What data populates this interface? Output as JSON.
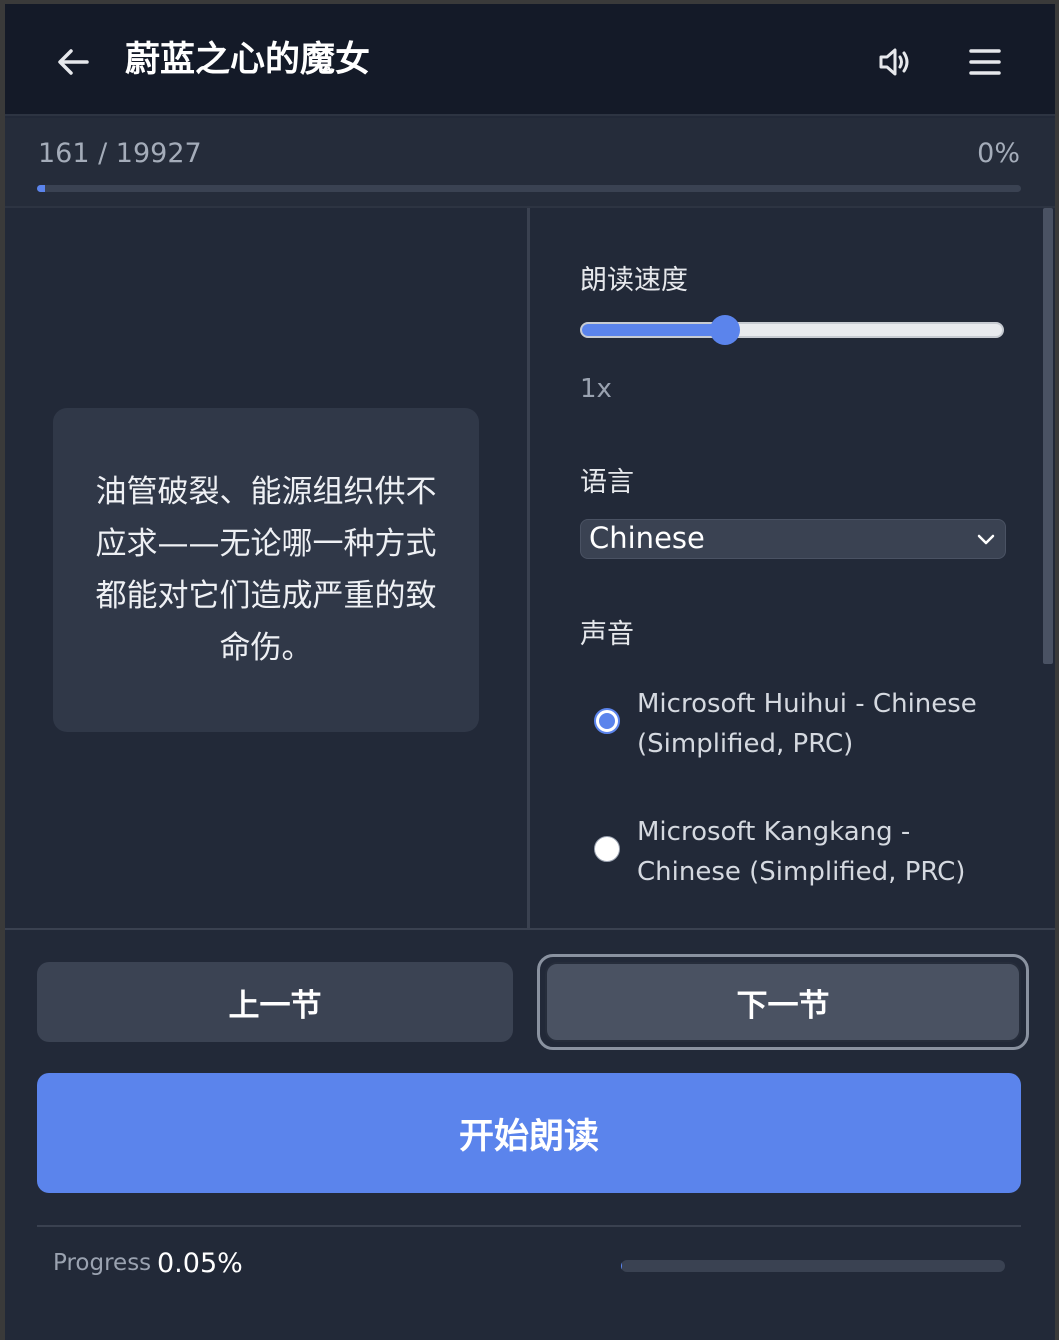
{
  "header": {
    "title": "蔚蓝之心的魔女",
    "back_icon": "arrow-left-icon",
    "speaker_icon": "speaker-icon",
    "menu_icon": "hamburger-menu-icon"
  },
  "position": {
    "text": "161 / 19927",
    "percent_text": "0%",
    "fraction": 0.008
  },
  "reader": {
    "text": "油管破裂、能源组织供不应求——无论哪一种方式都能对它们造成严重的致命伤。"
  },
  "settings": {
    "speed_label": "朗读速度",
    "speed_value": "1x",
    "speed_fraction": 0.34,
    "language_label": "语言",
    "language_value": "Chinese",
    "voice_label": "声音",
    "voices": [
      {
        "label": "Microsoft Huihui - Chinese (Simplified, PRC)",
        "selected": true
      },
      {
        "label": "Microsoft Kangkang - Chinese (Simplified, PRC)",
        "selected": false
      }
    ]
  },
  "controls": {
    "prev_label": "上一节",
    "next_label": "下一节",
    "start_label": "开始朗读"
  },
  "footer": {
    "progress_label": "Progress",
    "progress_value": "0.05%",
    "progress_fraction": 0.0005
  },
  "colors": {
    "accent": "#5b84ec",
    "background": "#222938",
    "header_bg": "#141a28"
  }
}
